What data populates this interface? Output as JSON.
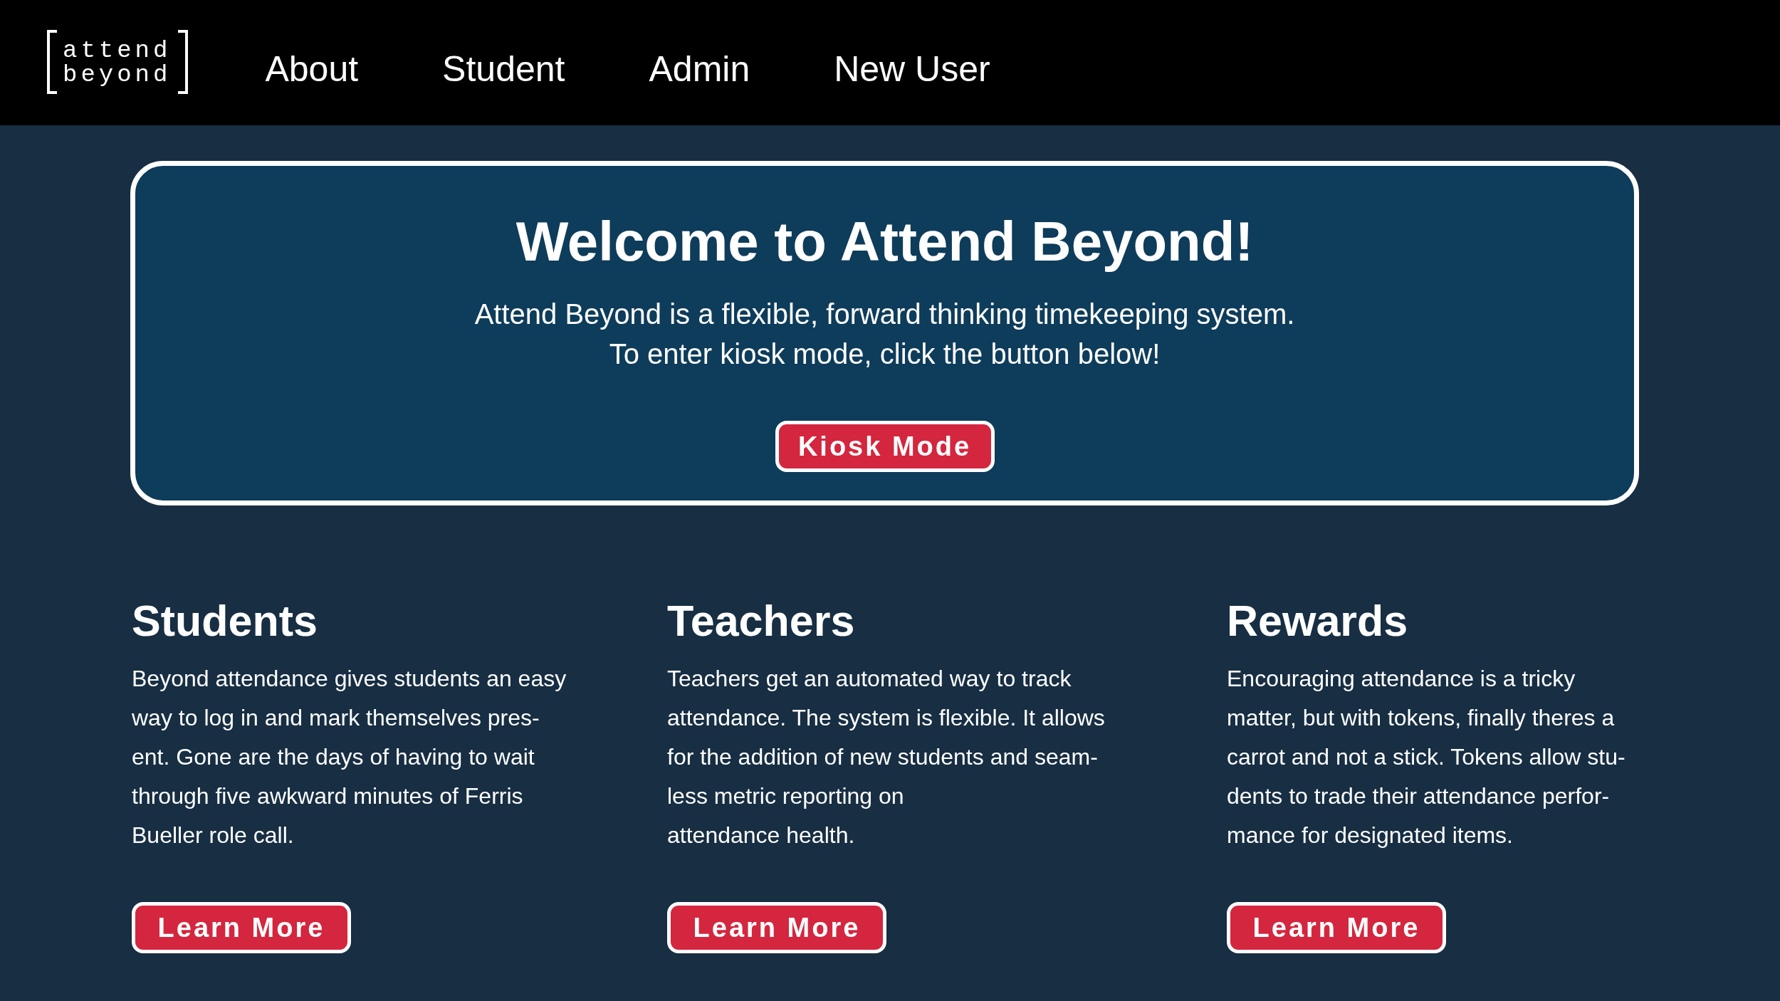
{
  "header": {
    "logo": [
      "attend",
      "beyond"
    ],
    "nav": [
      {
        "label": "About"
      },
      {
        "label": "Student"
      },
      {
        "label": "Admin"
      },
      {
        "label": "New User"
      }
    ]
  },
  "hero": {
    "title": "Welcome to Attend Beyond!",
    "lines": [
      "Attend Beyond is a flexible, forward thinking timekeeping system.",
      "To enter kiosk mode, click the button below!"
    ],
    "button": "Kiosk Mode"
  },
  "features": [
    {
      "heading": "Students",
      "lines": [
        "Beyond attendance gives students an easy",
        "way to log in and mark themselves pres-",
        "ent. Gone are the days of having to wait",
        "through five awkward minutes of Ferris",
        "Bueller role call."
      ],
      "button": "Learn More"
    },
    {
      "heading": "Teachers",
      "lines": [
        "Teachers get an automated way to track",
        "attendance. The system is flexible. It allows",
        "for the addition of new students and seam-",
        "less metric reporting on",
        "attendance health."
      ],
      "button": "Learn More"
    },
    {
      "heading": "Rewards",
      "lines": [
        "Encouraging attendance is a tricky",
        "matter, but with tokens, finally theres a",
        "carrot and not a stick. Tokens allow stu-",
        "dents to trade their attendance perfor-",
        "mance for designated items."
      ],
      "button": "Learn More"
    }
  ]
}
